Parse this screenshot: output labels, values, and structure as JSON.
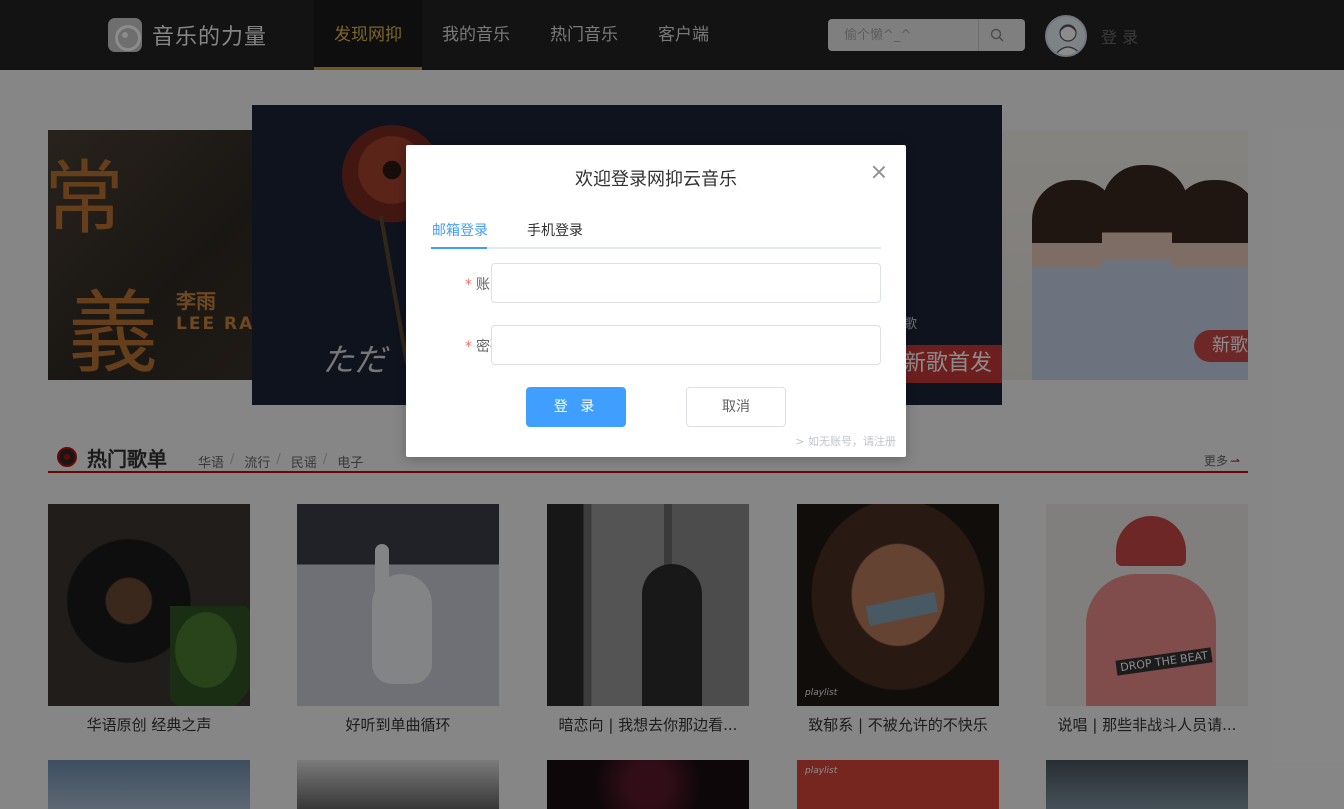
{
  "header": {
    "site_name": "音乐的力量",
    "nav": [
      "发现网抑",
      "我的音乐",
      "热门音乐",
      "客户端"
    ],
    "search_placeholder": "偷个懒^_^",
    "login_label": "登 录"
  },
  "banner": {
    "left_title_top": "常",
    "left_title_bottom": "義",
    "left_artist_cn": "李雨",
    "left_artist_en": "LEE RA",
    "center_script": "ただ",
    "center_subtitle": "歌",
    "center_tag": "新歌首发",
    "right_tag": "新歌"
  },
  "hot": {
    "title": "热门歌单",
    "tags": [
      "华语",
      "流行",
      "民谣",
      "电子"
    ],
    "more_label": "更多",
    "cards": [
      {
        "title": "华语原创 经典之声"
      },
      {
        "title": "好听到单曲循环"
      },
      {
        "title": "暗恋向 | 我想去你那边看..."
      },
      {
        "title": "致郁系 | 不被允许的不快乐"
      },
      {
        "title": "说唱 | 那些非战斗人员请..."
      }
    ],
    "card4_badge": "playlist",
    "card5_shirt": "DROP THE BEAT",
    "row2_card4_badge": "playlist"
  },
  "dialog": {
    "title": "欢迎登录网抑云音乐",
    "tabs": [
      "邮箱登录",
      "手机登录"
    ],
    "active_tab": "邮箱登录",
    "fields": {
      "account_label": "账号",
      "account_value": "",
      "password_label": "密码",
      "password_value": ""
    },
    "login_button": "登 录",
    "cancel_button": "取消",
    "register_hint": "> 如无账号，请注册"
  },
  "colors": {
    "accent": "#409eff",
    "brand_red": "#c10d0c",
    "nav_active": "#e0b84b"
  }
}
